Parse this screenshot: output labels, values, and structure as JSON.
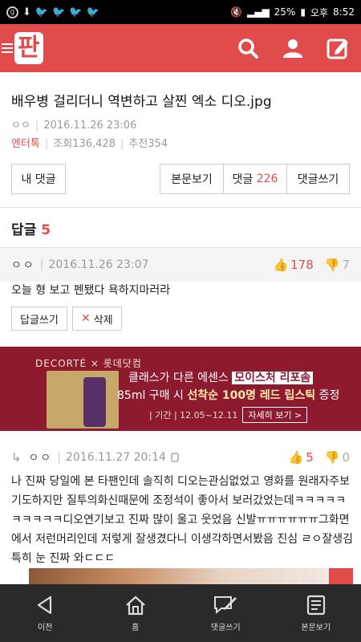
{
  "status": {
    "battery": "25%",
    "period": "오후",
    "time": "8:52"
  },
  "app": {
    "logo_text": "판",
    "brand_color": "#e04b4b"
  },
  "post": {
    "title": "배우병 걸리더니 역변하고 살찐 엑소 디오.jpg",
    "author": "ㅇㅇ",
    "datetime": "2016.11.26 23:06",
    "category": "엔터톡",
    "views": "조회136,428",
    "recommend": "추천354"
  },
  "buttons": {
    "my_comments": "내 댓글",
    "view_body": "본문보기",
    "comments_label": "댓글",
    "comments_count": "226",
    "write_comment": "댓글쓰기"
  },
  "replies": {
    "label": "답글",
    "count": "5"
  },
  "comment1": {
    "author": "ㅇㅇ",
    "datetime": "2016.11.26 23:07",
    "up": "178",
    "down": "7",
    "text": "오늘 형 보고 펜됐다 욕하지마러라",
    "reply_btn": "답글쓰기",
    "delete_btn": "삭제"
  },
  "ad": {
    "brand": "DECORTÉ × 롯데닷컴",
    "line1_pre": "클래스가 다른 에센스",
    "line1_hl": "모이스처 리포솜",
    "line2_pre": "85ml 구매 시",
    "line2_bold": "선착순 100명 레드 립스틱",
    "line2_post": "증정",
    "period": "| 기간 | 12.05~12.11",
    "detail_btn": "자세히 보기 >"
  },
  "comment2": {
    "author": "ㅇㅇ",
    "datetime": "2016.11.27 20:14",
    "up": "5",
    "down": "0",
    "text": "나 진짜 당일에 본 타팬인데 솔직히 디오는관심없었고 영화를 원래자주보기도하지만 질투의화신때문에 조정석이 좋아서 보러갔었는데ㅋㅋㅋㅋㅋㅋㅋㅋㅋㅋ디오연기보고 진짜 많이 울고 웃었음 신발ㅠㅠㅠㅠㅠㅠ그화면에서 저런머리인데 저렇게 잘생겼다니 이생각하면서봤음 진심 ㄹㅇ잘생김 특히 눈 진짜 와ㄷㄷㄷ"
  },
  "nav": {
    "prev": "이전",
    "home": "홈",
    "write": "댓글쓰기",
    "body": "본문보기"
  }
}
